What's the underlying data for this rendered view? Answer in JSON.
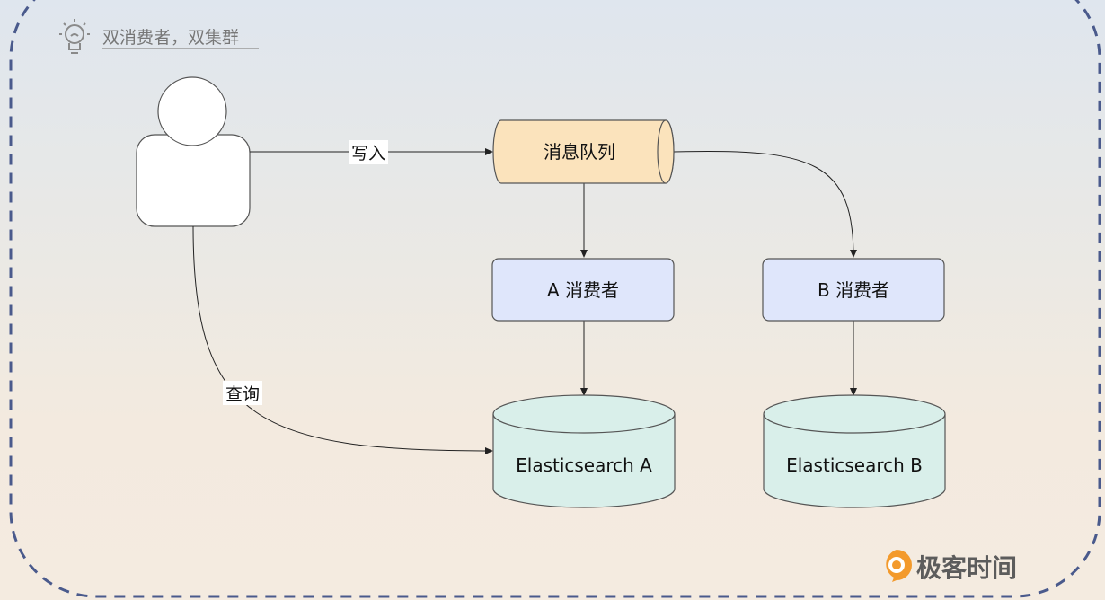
{
  "header": {
    "title": "双消费者，双集群",
    "icon": "lightbulb-icon"
  },
  "nodes": {
    "user": {
      "icon": "user-icon"
    },
    "queue": {
      "label": "消息队列"
    },
    "consumer_a": {
      "label": "A 消费者"
    },
    "consumer_b": {
      "label": "B 消费者"
    },
    "es_a": {
      "label": "Elasticsearch A"
    },
    "es_b": {
      "label": "Elasticsearch B"
    }
  },
  "edges": {
    "write": {
      "label": "写入"
    },
    "query": {
      "label": "查询"
    }
  },
  "brand": {
    "text": "极客时间",
    "icon": "geektime-logo-icon"
  },
  "colors": {
    "queue_fill": "#fbe3bc",
    "consumer_fill": "#dfe6fb",
    "db_fill": "#d9efea",
    "border_dash": "#4a5a8c",
    "brand_orange": "#f39a2c"
  }
}
